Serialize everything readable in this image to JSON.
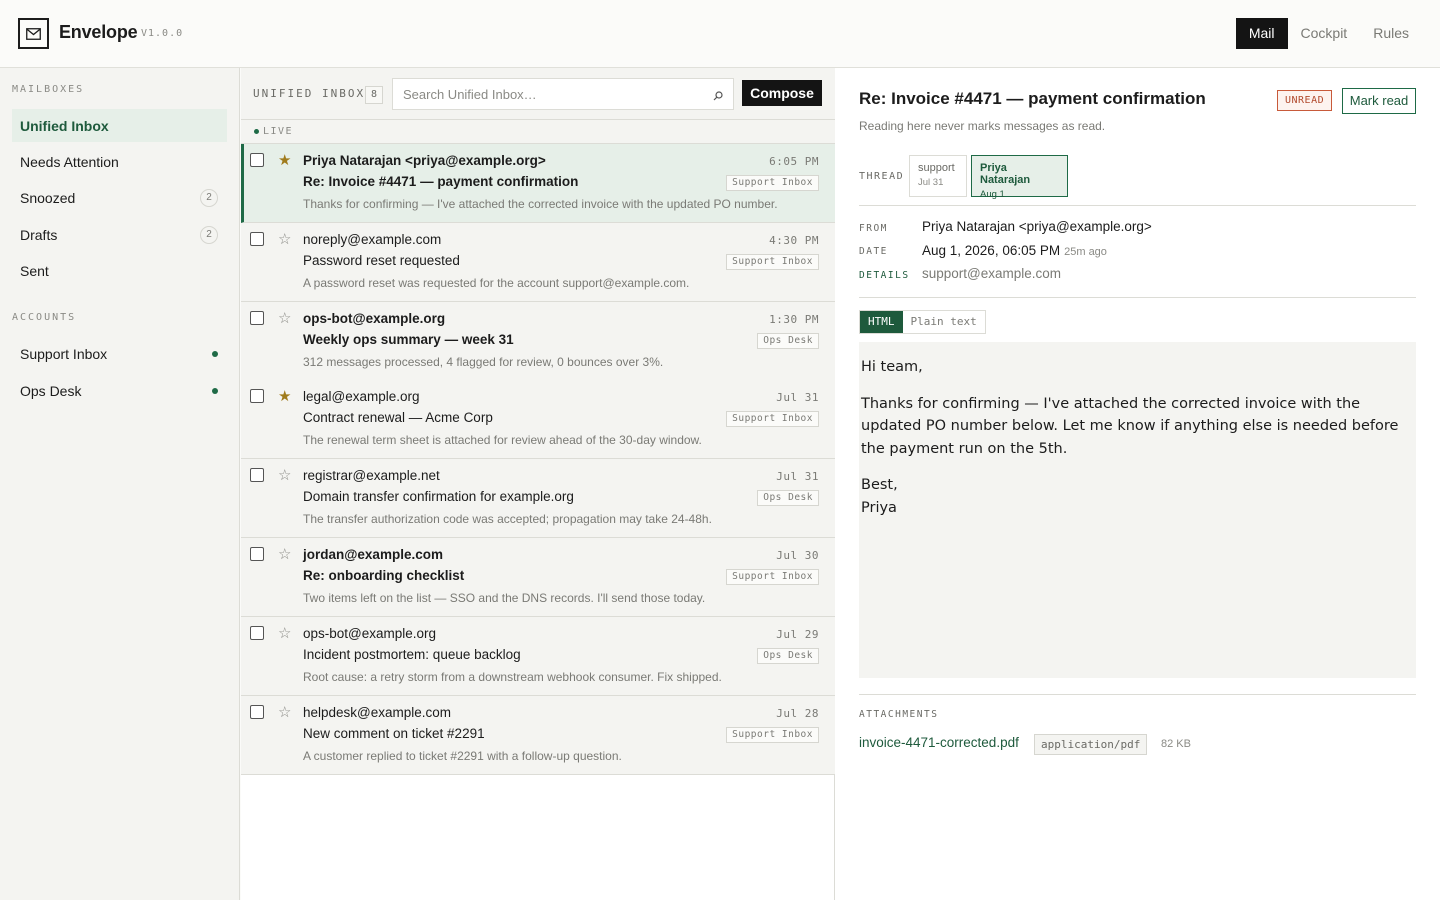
{
  "app": {
    "name": "Envelope",
    "version": "V1.0.0"
  },
  "topnav": [
    {
      "label": "Mail",
      "active": true
    },
    {
      "label": "Cockpit",
      "active": false
    },
    {
      "label": "Rules",
      "active": false
    }
  ],
  "sidebar": {
    "mailboxes_title": "MAILBOXES",
    "mailboxes": [
      {
        "label": "Unified Inbox",
        "count": ""
      },
      {
        "label": "Needs Attention",
        "count": ""
      },
      {
        "label": "Snoozed",
        "count": "2"
      },
      {
        "label": "Drafts",
        "count": "2"
      },
      {
        "label": "Sent",
        "count": ""
      }
    ],
    "accounts_title": "ACCOUNTS",
    "accounts": [
      {
        "label": "Support Inbox"
      },
      {
        "label": "Ops Desk"
      }
    ]
  },
  "list": {
    "title": "UNIFIED INBOX",
    "count": "8",
    "search_placeholder": "Search Unified Inbox…",
    "compose_label": "Compose",
    "live_label": "LIVE",
    "messages": [
      {
        "from": "Priya Natarajan <priya@example.org>",
        "subject": "Re: Invoice #4471 — payment confirmation",
        "snippet": "Thanks for confirming — I've attached the corrected invoice with the updated PO number.",
        "time": "6:05 PM",
        "tag": "Support Inbox",
        "starred": true,
        "unread": true
      },
      {
        "from": "noreply@example.com",
        "subject": "Password reset requested",
        "snippet": "A password reset was requested for the account support@example.com.",
        "time": "4:30 PM",
        "tag": "Support Inbox",
        "starred": false,
        "unread": false
      },
      {
        "from": "ops-bot@example.org",
        "subject": "Weekly ops summary — week 31",
        "snippet": "312 messages processed, 4 flagged for review, 0 bounces over 3%.",
        "time": "1:30 PM",
        "tag": "Ops Desk",
        "starred": false,
        "unread": true
      },
      {
        "from": "legal@example.org",
        "subject": "Contract renewal — Acme Corp",
        "snippet": "The renewal term sheet is attached for review ahead of the 30-day window.",
        "time": "Jul 31",
        "tag": "Support Inbox",
        "starred": true,
        "unread": false
      },
      {
        "from": "registrar@example.net",
        "subject": "Domain transfer confirmation for example.org",
        "snippet": "The transfer authorization code was accepted; propagation may take 24-48h.",
        "time": "Jul 31",
        "tag": "Ops Desk",
        "starred": false,
        "unread": false
      },
      {
        "from": "jordan@example.com",
        "subject": "Re: onboarding checklist",
        "snippet": "Two items left on the list — SSO and the DNS records. I'll send those today.",
        "time": "Jul 30",
        "tag": "Support Inbox",
        "starred": false,
        "unread": true
      },
      {
        "from": "ops-bot@example.org",
        "subject": "Incident postmortem: queue backlog",
        "snippet": "Root cause: a retry storm from a downstream webhook consumer. Fix shipped.",
        "time": "Jul 29",
        "tag": "Ops Desk",
        "starred": false,
        "unread": false
      },
      {
        "from": "helpdesk@example.com",
        "subject": "New comment on ticket #2291",
        "snippet": "A customer replied to ticket #2291 with a follow-up question.",
        "time": "Jul 28",
        "tag": "Support Inbox",
        "starred": false,
        "unread": false
      }
    ]
  },
  "reader": {
    "subject": "Re: Invoice #4471 — payment confirmation",
    "unread_badge": "UNREAD",
    "mark_read_label": "Mark read",
    "note": "Reading here never marks messages as read.",
    "thread_label": "THREAD",
    "thread": [
      {
        "name": "support",
        "date": "Jul 31",
        "active": false
      },
      {
        "name": "Priya Natarajan",
        "date": "Aug 1",
        "active": true
      }
    ],
    "from_label": "FROM",
    "from": "Priya Natarajan <priya@example.org>",
    "date_label": "DATE",
    "date": "Aug 1, 2026, 06:05 PM",
    "date_ago": "25m ago",
    "details_label": "DETAILS",
    "details": "support@example.com",
    "view_html": "HTML",
    "view_plain": "Plain text",
    "body": [
      "Hi team,",
      "Thanks for confirming — I've attached the corrected invoice with the updated PO number below. Let me know if anything else is needed before the payment run on the 5th.",
      "Best,",
      "Priya"
    ],
    "attachments_label": "ATTACHMENTS",
    "attachment": {
      "name": "invoice-4471-corrected.pdf",
      "type": "application/pdf",
      "size": "82 KB"
    }
  },
  "colors": {
    "accent": "#1e6a46",
    "accent_bg": "#e6efe8",
    "star": "#a07b1c",
    "unread": "#b24a2e"
  }
}
